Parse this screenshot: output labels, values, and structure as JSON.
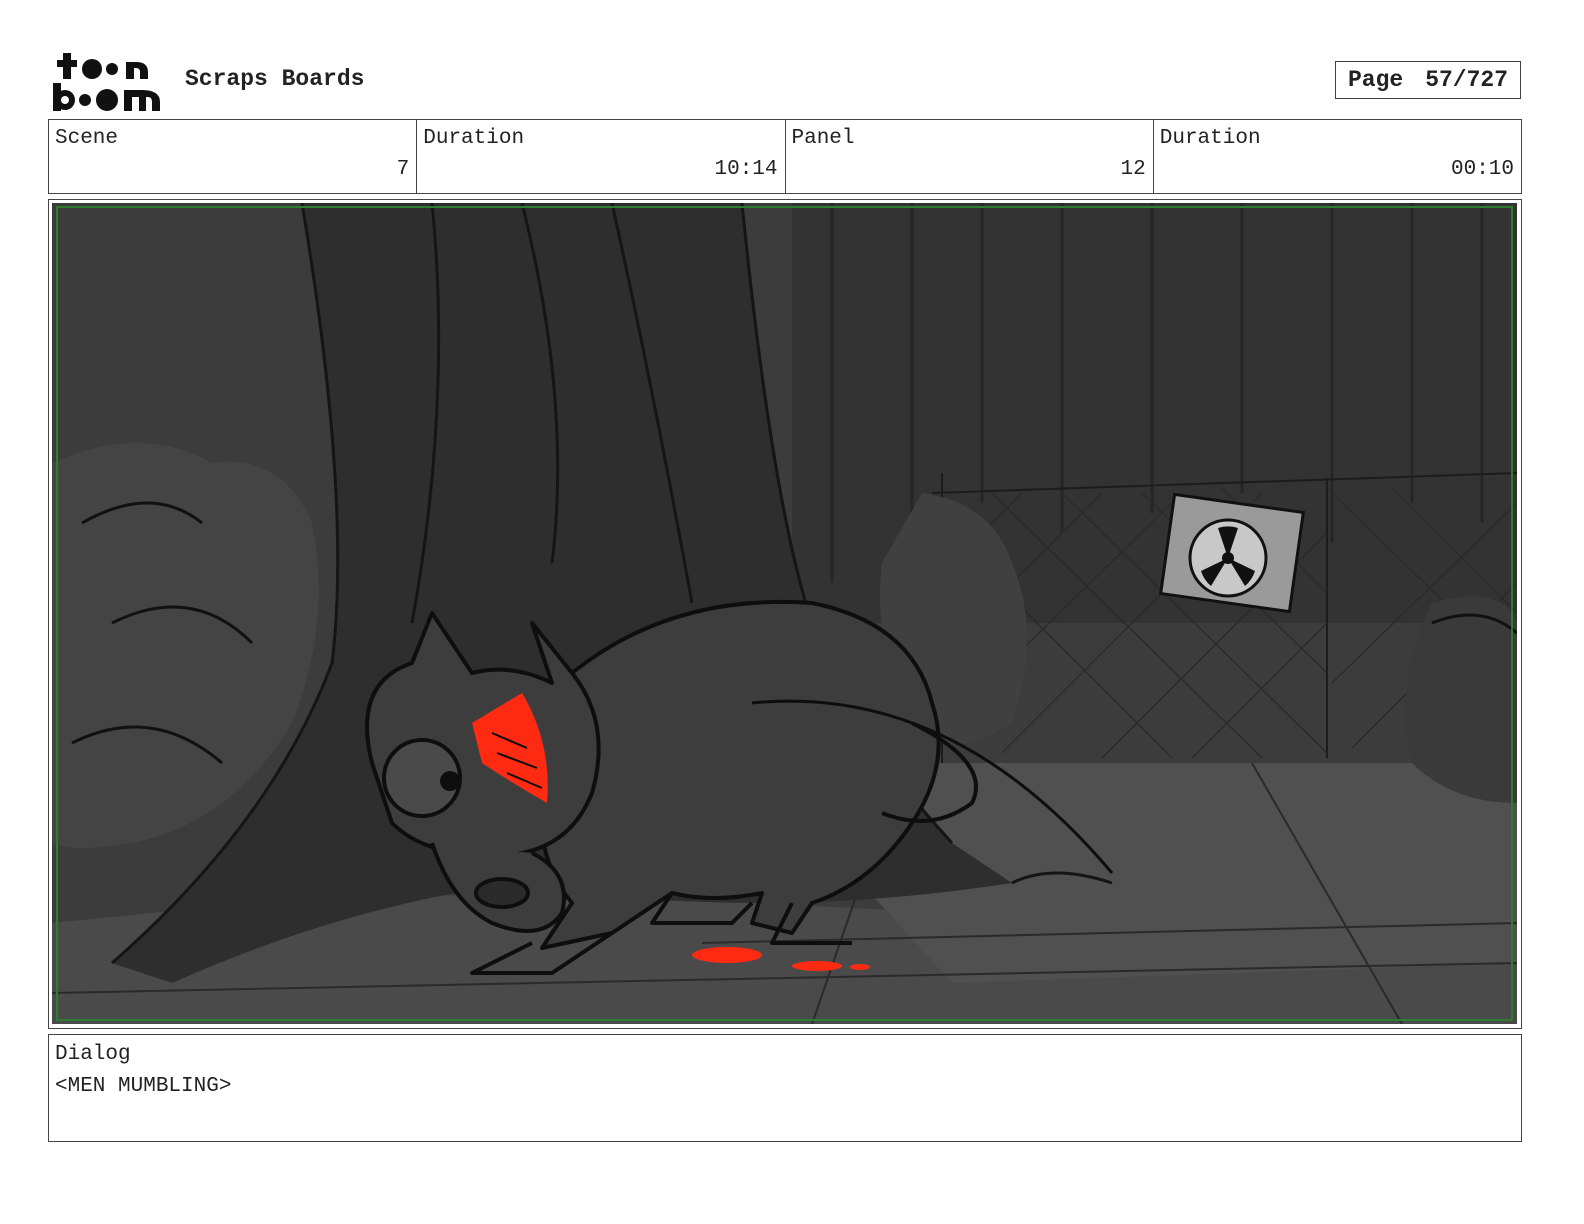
{
  "header": {
    "logo_text": "toonboom",
    "project_title": "Scraps Boards",
    "page_label": "Page",
    "page_value": "57/727"
  },
  "info": {
    "scene_label": "Scene",
    "scene_value": "7",
    "scene_duration_label": "Duration",
    "scene_duration_value": "10:14",
    "panel_label": "Panel",
    "panel_value": "12",
    "panel_duration_label": "Duration",
    "panel_duration_value": "00:10"
  },
  "panel": {
    "image": "storyboard-sketch-creature-sniffing-blood-near-radioactive-fence",
    "colors": {
      "blood": "#ff2a12",
      "ground": "#4a4a4a",
      "sky": "#3a3a3a",
      "safe_frame": "#2e7d2e"
    }
  },
  "dialog": {
    "label": "Dialog",
    "text": "<MEN MUMBLING>"
  }
}
